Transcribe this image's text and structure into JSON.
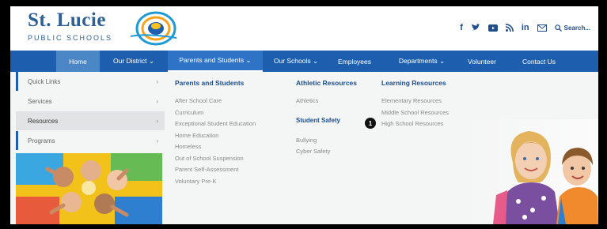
{
  "header": {
    "logo_title": "St. Lucie",
    "logo_subtitle": "PUBLIC SCHOOLS",
    "search_label": "Search..."
  },
  "social_icons": [
    "facebook-icon",
    "twitter-icon",
    "youtube-icon",
    "rss-icon",
    "linkedin-icon",
    "email-icon"
  ],
  "nav": {
    "items": [
      {
        "label": "Home"
      },
      {
        "label": "Our District ⌄"
      },
      {
        "label": "Parents and Students ⌄"
      },
      {
        "label": "Our Schools ⌄"
      },
      {
        "label": "Employees"
      },
      {
        "label": "Departments ⌄"
      },
      {
        "label": "Volunteer"
      },
      {
        "label": "Contact Us"
      }
    ]
  },
  "left_menu": {
    "items": [
      {
        "label": "Quick Links"
      },
      {
        "label": "Services"
      },
      {
        "label": "Resources"
      },
      {
        "label": "Programs"
      }
    ],
    "chevron": "›"
  },
  "columns": {
    "parents": {
      "heading": "Parents and Students",
      "links": [
        "After School Care",
        "Curriculum",
        "Exceptional Student Education",
        "Home Education",
        "Homeless",
        "Out of School Suspension",
        "Parent Self-Assessment",
        "Voluntary Pre-K"
      ]
    },
    "athletic": {
      "heading": "Athletic Resources",
      "links": [
        "Athletics"
      ],
      "safety_heading": "Student Safety",
      "safety_links": [
        "Bullying",
        "Cyber Safety"
      ]
    },
    "learning": {
      "heading": "Learning Resources",
      "links": [
        "Elementary Resources",
        "Middle School Resources",
        "High School Resources"
      ]
    }
  },
  "annotation": {
    "badge": "1"
  },
  "colors": {
    "nav_blue": "#1d5fae",
    "brand_blue": "#2b5f95",
    "menu_bg": "#f4f5f5"
  }
}
